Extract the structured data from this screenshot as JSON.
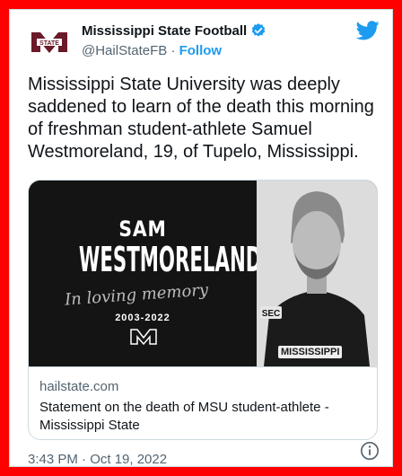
{
  "account": {
    "name": "Mississippi State Football",
    "handle": "@HailStateFB",
    "separator": "·",
    "follow_label": "Follow",
    "avatar_text": "STATE"
  },
  "tweet": {
    "text": "Mississippi State University was deeply saddened to learn of the death this morning of freshman student-athlete Samuel Westmoreland, 19, of Tupelo, Mississippi."
  },
  "card": {
    "image_text": {
      "first_name": "SAM",
      "last_name": "WESTMORELAND",
      "script": "In loving memory",
      "years": "2003-2022",
      "jersey": "MISSISSIPPI"
    },
    "domain": "hailstate.com",
    "title": "Statement on the death of MSU student-athlete - Mississippi State"
  },
  "footer": {
    "timestamp": "3:43 PM · Oct 19, 2022"
  },
  "colors": {
    "frame": "#ff0000",
    "accent": "#1d9bf0",
    "brand_maroon": "#6b1a2a"
  }
}
